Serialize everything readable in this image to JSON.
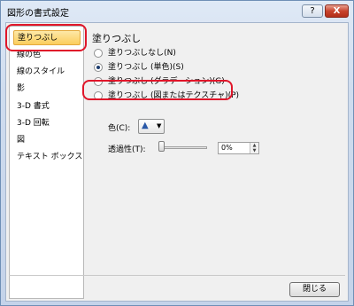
{
  "window": {
    "title": "図形の書式設定",
    "help_label": "?",
    "close_label": "X"
  },
  "sidebar": {
    "items": [
      {
        "label": "塗りつぶし",
        "selected": true
      },
      {
        "label": "線の色"
      },
      {
        "label": "線のスタイル"
      },
      {
        "label": "影"
      },
      {
        "label": "3-D 書式"
      },
      {
        "label": "3-D 回転"
      },
      {
        "label": "図"
      },
      {
        "label": "テキスト ボックス"
      }
    ]
  },
  "panel": {
    "title": "塗りつぶし",
    "options": [
      {
        "label": "塗りつぶしなし(N)",
        "checked": false
      },
      {
        "label": "塗りつぶし (単色)(S)",
        "checked": true
      },
      {
        "label": "塗りつぶし (グラデーション)(G)",
        "checked": false
      },
      {
        "label": "塗りつぶし (図またはテクスチャ)(P)",
        "checked": false
      }
    ],
    "color_label": "色(C):",
    "transparency_label": "透過性(T):",
    "transparency_value": "0%",
    "transparency_level": 0
  },
  "footer": {
    "close_button": "閉じる"
  },
  "colors": {
    "highlight": "#e0162a",
    "selected_item": "#fbcd5d"
  }
}
